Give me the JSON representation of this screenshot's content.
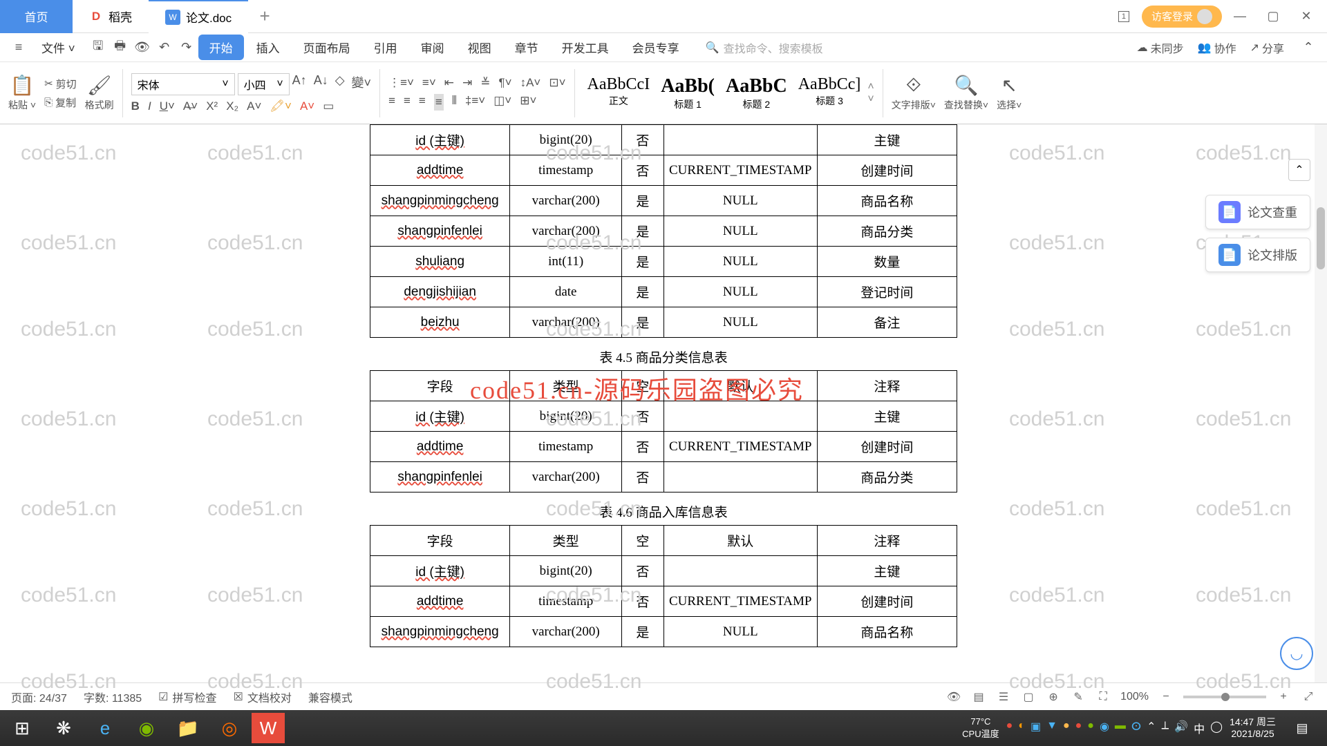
{
  "tabs": {
    "home": "首页",
    "daoke": "稻壳",
    "doc": "论文.doc"
  },
  "login": "访客登录",
  "menu": {
    "file": "文件",
    "items": [
      "开始",
      "插入",
      "页面布局",
      "引用",
      "审阅",
      "视图",
      "章节",
      "开发工具",
      "会员专享"
    ],
    "search_ph": "查找命令、搜索模板",
    "right": {
      "unsync": "未同步",
      "collab": "协作",
      "share": "分享"
    }
  },
  "ribbon": {
    "paste": "粘贴",
    "cut": "剪切",
    "copy": "复制",
    "brush": "格式刷",
    "font": "宋体",
    "size": "小四",
    "styles": [
      {
        "prev": "AaBbCcI",
        "name": "正文"
      },
      {
        "prev": "AaBb(",
        "name": "标题 1"
      },
      {
        "prev": "AaBbC",
        "name": "标题 2"
      },
      {
        "prev": "AaBbCc]",
        "name": "标题 3"
      }
    ],
    "layout": "文字排版",
    "replace": "查找替换",
    "select": "选择"
  },
  "doc": {
    "t1": [
      [
        "id (主键)",
        "bigint(20)",
        "否",
        "",
        "主键"
      ],
      [
        "addtime",
        "timestamp",
        "否",
        "CURRENT_TIMESTAMP",
        "创建时间"
      ],
      [
        "shangpinmingcheng",
        "varchar(200)",
        "是",
        "NULL",
        "商品名称"
      ],
      [
        "shangpinfenlei",
        "varchar(200)",
        "是",
        "NULL",
        "商品分类"
      ],
      [
        "shuliang",
        "int(11)",
        "是",
        "NULL",
        "数量"
      ],
      [
        "dengjishijian",
        "date",
        "是",
        "NULL",
        "登记时间"
      ],
      [
        "beizhu",
        "varchar(200)",
        "是",
        "NULL",
        "备注"
      ]
    ],
    "cap2": "表 4.5  商品分类信息表",
    "hdr": [
      "字段",
      "类型",
      "空",
      "默认",
      "注释"
    ],
    "t2": [
      [
        "id (主键)",
        "bigint(20)",
        "否",
        "",
        "主键"
      ],
      [
        "addtime",
        "timestamp",
        "否",
        "CURRENT_TIMESTAMP",
        "创建时间"
      ],
      [
        "shangpinfenlei",
        "varchar(200)",
        "否",
        "",
        "商品分类"
      ]
    ],
    "cap3": "表 4.6  商品入库信息表",
    "t3": [
      [
        "id (主键)",
        "bigint(20)",
        "否",
        "",
        "主键"
      ],
      [
        "addtime",
        "timestamp",
        "否",
        "CURRENT_TIMESTAMP",
        "创建时间"
      ],
      [
        "shangpinmingcheng",
        "varchar(200)",
        "是",
        "NULL",
        "商品名称"
      ]
    ]
  },
  "side": {
    "check": "论文查重",
    "format": "论文排版"
  },
  "status": {
    "page": "页面: 24/37",
    "words": "字数: 11385",
    "spell": "拼写检查",
    "proof": "文档校对",
    "compat": "兼容模式",
    "zoom": "100%"
  },
  "taskbar": {
    "temp": "77°C",
    "cpu": "CPU温度",
    "time": "14:47 周三",
    "date": "2021/8/25",
    "ime": "中"
  },
  "wm": "code51.cn",
  "redwm": "code51.cn-源码乐园盗图必究"
}
